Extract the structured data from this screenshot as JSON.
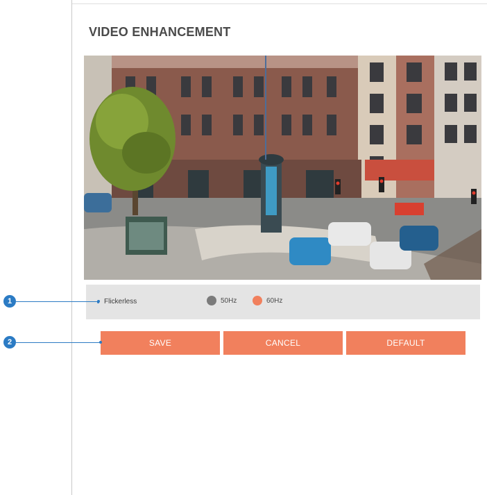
{
  "page": {
    "title": "VIDEO ENHANCEMENT"
  },
  "preview": {
    "icon": "camera-live-preview"
  },
  "settings": {
    "flickerless": {
      "label": "Flickerless",
      "options": [
        {
          "label": "50Hz",
          "selected": false,
          "color": "#7b7b7b"
        },
        {
          "label": "60Hz",
          "selected": true,
          "color": "#f1805d"
        }
      ]
    }
  },
  "buttons": {
    "save": "SAVE",
    "cancel": "CANCEL",
    "default": "DEFAULT"
  },
  "callouts": {
    "one": "1",
    "two": "2"
  },
  "colors": {
    "accent": "#f1805d",
    "callout": "#2b7bc4"
  }
}
